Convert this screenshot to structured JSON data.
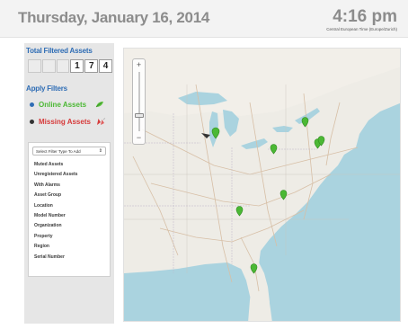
{
  "header": {
    "date": "Thursday, January 16, 2014",
    "time": "4:16 pm",
    "timezone": "Central European Time (Europe/Zurich)"
  },
  "sidebar": {
    "total_title": "Total Filtered Assets",
    "counter_digits": [
      "",
      "",
      "",
      "1",
      "7",
      "4"
    ],
    "apply_title": "Apply Filters",
    "online_label": "Online Assets",
    "missing_label": "Missing Assets",
    "filter_select_placeholder": "Select Filter Type To Add",
    "filter_options": [
      "Muted Assets",
      "Unregistered Assets",
      "With Alarms",
      "Asset Group",
      "Location",
      "Model Number",
      "Organization",
      "Property",
      "Region",
      "Serial Number"
    ]
  },
  "map": {
    "zoom_in": "+",
    "zoom_out": "−",
    "zoom_level": 0.7
  },
  "colors": {
    "accent_blue": "#2f6db5",
    "online_green": "#4bb834",
    "missing_red": "#d63a3a",
    "water": "#aad3df",
    "land": "#eeece6"
  },
  "icons": [
    "leaf-icon",
    "alert-icon",
    "map-pin-icon",
    "chevron-icon"
  ]
}
